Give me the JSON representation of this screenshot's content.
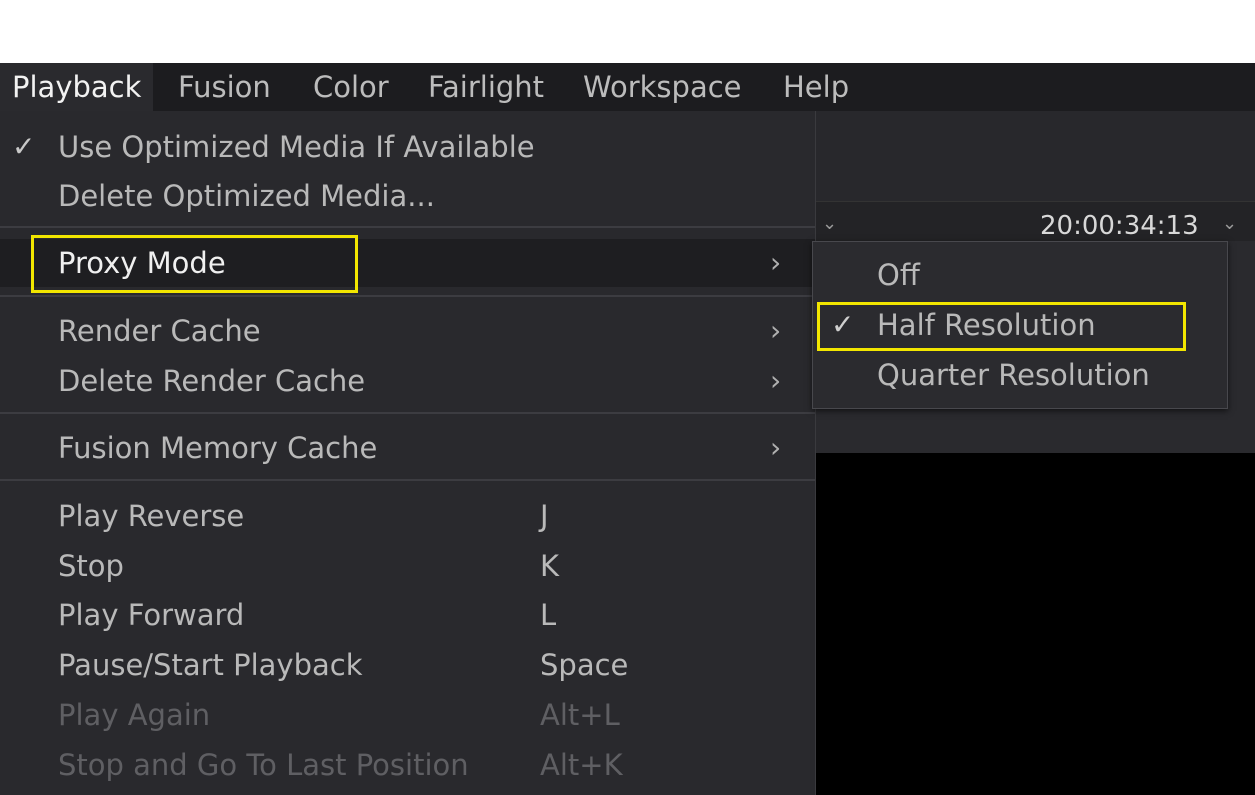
{
  "menubar": {
    "items": [
      "Playback",
      "Fusion",
      "Color",
      "Fairlight",
      "Workspace",
      "Help"
    ]
  },
  "background": {
    "timecode": "20:00:34:13"
  },
  "playback_menu": {
    "items": [
      {
        "label": "Use Optimized Media If Available",
        "checked": true
      },
      {
        "label": "Delete Optimized Media..."
      },
      {
        "label": "Proxy Mode",
        "submenu": true
      },
      {
        "label": "Render Cache",
        "submenu": true
      },
      {
        "label": "Delete Render Cache",
        "submenu": true
      },
      {
        "label": "Fusion Memory Cache",
        "submenu": true
      },
      {
        "label": "Play Reverse",
        "shortcut": "J"
      },
      {
        "label": "Stop",
        "shortcut": "K"
      },
      {
        "label": "Play Forward",
        "shortcut": "L"
      },
      {
        "label": "Pause/Start Playback",
        "shortcut": "Space"
      },
      {
        "label": "Play Again",
        "shortcut": "Alt+L",
        "disabled": true
      },
      {
        "label": "Stop and Go To Last Position",
        "shortcut": "Alt+K",
        "disabled": true
      }
    ]
  },
  "proxy_submenu": {
    "items": [
      {
        "label": "Off"
      },
      {
        "label": "Half Resolution",
        "checked": true
      },
      {
        "label": "Quarter Resolution"
      }
    ]
  },
  "icons": {
    "check": "✓",
    "submenu_arrow": "›",
    "chevron_down": "⌄"
  },
  "colors": {
    "highlight": "#f2e600",
    "menu_bg": "#29292d",
    "viewer_bg": "#000000"
  }
}
